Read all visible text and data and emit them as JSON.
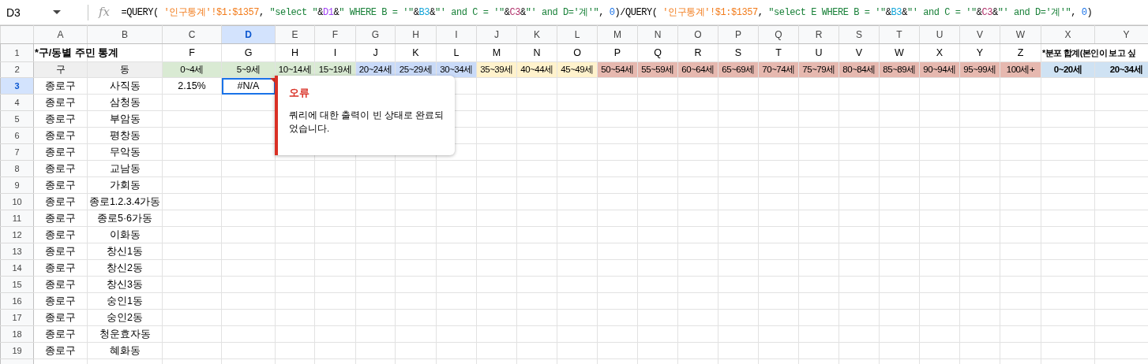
{
  "name_box": "D3",
  "formula_label": "fx",
  "formula": [
    {
      "text": "=QUERY( ",
      "kind": "plain"
    },
    {
      "text": "'인구통계'!$1:$1357",
      "kind": "range"
    },
    {
      "text": ", ",
      "kind": "plain"
    },
    {
      "text": "\"select \"",
      "kind": "string"
    },
    {
      "text": "&",
      "kind": "plain"
    },
    {
      "text": "D1",
      "kind": "ref-a"
    },
    {
      "text": "&",
      "kind": "plain"
    },
    {
      "text": "\" WHERE B = '\"",
      "kind": "string"
    },
    {
      "text": "&",
      "kind": "plain"
    },
    {
      "text": "B3",
      "kind": "ref-b"
    },
    {
      "text": "&",
      "kind": "plain"
    },
    {
      "text": "\"' and C = '\"",
      "kind": "string"
    },
    {
      "text": "&",
      "kind": "plain"
    },
    {
      "text": "C3",
      "kind": "ref-c"
    },
    {
      "text": "&",
      "kind": "plain"
    },
    {
      "text": "\"' and D='계'\"",
      "kind": "string"
    },
    {
      "text": ", ",
      "kind": "plain"
    },
    {
      "text": "0",
      "kind": "number"
    },
    {
      "text": ")/QUERY( ",
      "kind": "plain"
    },
    {
      "text": "'인구통계'!$1:$1357",
      "kind": "range"
    },
    {
      "text": ", ",
      "kind": "plain"
    },
    {
      "text": "\"select E WHERE B = '\"",
      "kind": "string"
    },
    {
      "text": "&",
      "kind": "plain"
    },
    {
      "text": "B3",
      "kind": "ref-b"
    },
    {
      "text": "&",
      "kind": "plain"
    },
    {
      "text": "\"' and C = '\"",
      "kind": "string"
    },
    {
      "text": "&",
      "kind": "plain"
    },
    {
      "text": "C3",
      "kind": "ref-c"
    },
    {
      "text": "&",
      "kind": "plain"
    },
    {
      "text": "\"' and D='계'\"",
      "kind": "string"
    },
    {
      "text": ", ",
      "kind": "plain"
    },
    {
      "text": "0",
      "kind": "number"
    },
    {
      "text": ")",
      "kind": "plain"
    }
  ],
  "columns": [
    {
      "label": "A",
      "selected": false
    },
    {
      "label": "B",
      "selected": false
    },
    {
      "label": "C",
      "selected": false
    },
    {
      "label": "D",
      "selected": true
    },
    {
      "label": "E",
      "selected": false
    },
    {
      "label": "F",
      "selected": false
    },
    {
      "label": "G",
      "selected": false
    },
    {
      "label": "H",
      "selected": false
    },
    {
      "label": "I",
      "selected": false
    },
    {
      "label": "J",
      "selected": false
    },
    {
      "label": "K",
      "selected": false
    },
    {
      "label": "L",
      "selected": false
    },
    {
      "label": "M",
      "selected": false
    },
    {
      "label": "N",
      "selected": false
    },
    {
      "label": "O",
      "selected": false
    },
    {
      "label": "P",
      "selected": false
    },
    {
      "label": "Q",
      "selected": false
    },
    {
      "label": "R",
      "selected": false
    },
    {
      "label": "S",
      "selected": false
    },
    {
      "label": "T",
      "selected": false
    },
    {
      "label": "U",
      "selected": false
    },
    {
      "label": "V",
      "selected": false
    },
    {
      "label": "W",
      "selected": false
    },
    {
      "label": "X",
      "selected": false
    },
    {
      "label": "Y",
      "selected": false
    }
  ],
  "title_row": {
    "number": "1",
    "selected": false,
    "title": "*구/동별 주민 통계",
    "labels": [
      "F",
      "G",
      "H",
      "I",
      "J",
      "K",
      "L",
      "M",
      "N",
      "O",
      "P",
      "Q",
      "R",
      "S",
      "T",
      "U",
      "V",
      "W",
      "X",
      "Y",
      "Z"
    ],
    "summary_title": "*분포 합계(본인이 보고 싶"
  },
  "header_row": {
    "number": "2",
    "selected": false,
    "cells": [
      {
        "text": "구",
        "color": "#efefef",
        "bold": false
      },
      {
        "text": "동",
        "color": "#efefef",
        "bold": false
      },
      {
        "text": "0~4세",
        "color": "#d9ead3",
        "bold": false
      },
      {
        "text": "5~9세",
        "color": "#d9ead3",
        "bold": false
      },
      {
        "text": "10~14세",
        "color": "#d9ead3",
        "bold": false
      },
      {
        "text": "15~19세",
        "color": "#d9ead3",
        "bold": false
      },
      {
        "text": "20~24세",
        "color": "#c9daf8",
        "bold": false
      },
      {
        "text": "25~29세",
        "color": "#c9daf8",
        "bold": false
      },
      {
        "text": "30~34세",
        "color": "#c9daf8",
        "bold": false
      },
      {
        "text": "35~39세",
        "color": "#fff2cc",
        "bold": false
      },
      {
        "text": "40~44세",
        "color": "#fff2cc",
        "bold": false
      },
      {
        "text": "45~49세",
        "color": "#fff2cc",
        "bold": false
      },
      {
        "text": "50~54세",
        "color": "#e6b8af",
        "bold": false
      },
      {
        "text": "55~59세",
        "color": "#e6b8af",
        "bold": false
      },
      {
        "text": "60~64세",
        "color": "#e6b8af",
        "bold": false
      },
      {
        "text": "65~69세",
        "color": "#e6b8af",
        "bold": false
      },
      {
        "text": "70~74세",
        "color": "#e6b8af",
        "bold": false
      },
      {
        "text": "75~79세",
        "color": "#e6b8af",
        "bold": false
      },
      {
        "text": "80~84세",
        "color": "#e6b8af",
        "bold": false
      },
      {
        "text": "85~89세",
        "color": "#e6b8af",
        "bold": false
      },
      {
        "text": "90~94세",
        "color": "#e6b8af",
        "bold": false
      },
      {
        "text": "95~99세",
        "color": "#e6b8af",
        "bold": false
      },
      {
        "text": "100세+",
        "color": "#e6b8af",
        "bold": false
      },
      {
        "text": "0~20세",
        "color": "#cfe2f3",
        "bold": true
      },
      {
        "text": "20~34세",
        "color": "#cfe2f3",
        "bold": true
      }
    ]
  },
  "rows": [
    {
      "number": "3",
      "selected": true,
      "district": "종로구",
      "dong": "사직동",
      "values": [
        {
          "text": "2.15%",
          "error": false
        },
        {
          "text": "#N/A",
          "error": true
        }
      ]
    },
    {
      "number": "4",
      "selected": false,
      "district": "종로구",
      "dong": "삼청동"
    },
    {
      "number": "5",
      "selected": false,
      "district": "종로구",
      "dong": "부암동"
    },
    {
      "number": "6",
      "selected": false,
      "district": "종로구",
      "dong": "평창동"
    },
    {
      "number": "7",
      "selected": false,
      "district": "종로구",
      "dong": "무악동"
    },
    {
      "number": "8",
      "selected": false,
      "district": "종로구",
      "dong": "교남동"
    },
    {
      "number": "9",
      "selected": false,
      "district": "종로구",
      "dong": "가회동"
    },
    {
      "number": "10",
      "selected": false,
      "district": "종로구",
      "dong": "종로1.2.3.4가동"
    },
    {
      "number": "11",
      "selected": false,
      "district": "종로구",
      "dong": "종로5·6가동"
    },
    {
      "number": "12",
      "selected": false,
      "district": "종로구",
      "dong": "이화동"
    },
    {
      "number": "13",
      "selected": false,
      "district": "종로구",
      "dong": "창신1동"
    },
    {
      "number": "14",
      "selected": false,
      "district": "종로구",
      "dong": "창신2동"
    },
    {
      "number": "15",
      "selected": false,
      "district": "종로구",
      "dong": "창신3동"
    },
    {
      "number": "16",
      "selected": false,
      "district": "종로구",
      "dong": "숭인1동"
    },
    {
      "number": "17",
      "selected": false,
      "district": "종로구",
      "dong": "숭인2동"
    },
    {
      "number": "18",
      "selected": false,
      "district": "종로구",
      "dong": "청운효자동"
    },
    {
      "number": "19",
      "selected": false,
      "district": "종로구",
      "dong": "혜화동"
    }
  ],
  "tooltip": {
    "title": "오류",
    "message": "쿼리에 대한 출력이 빈 상태로 완료되었습니다."
  }
}
